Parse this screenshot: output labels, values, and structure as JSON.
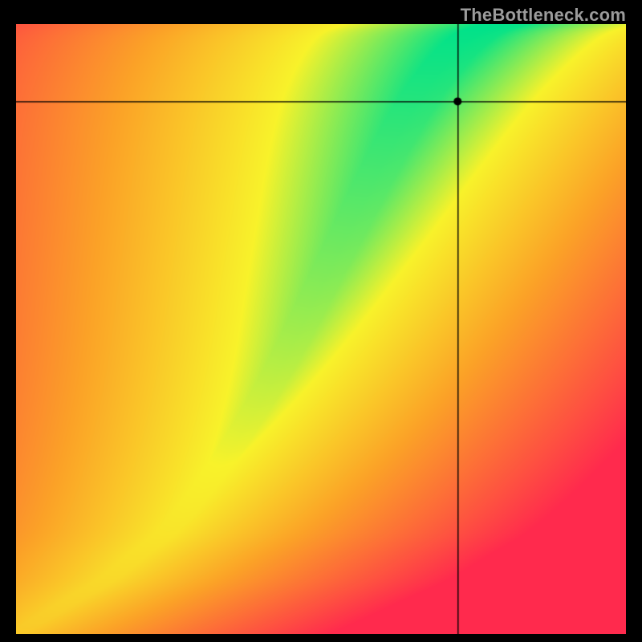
{
  "watermark": "TheBottleneck.com",
  "chart_data": {
    "type": "heatmap",
    "title": "",
    "xlabel": "",
    "ylabel": "",
    "xlim": [
      0,
      1
    ],
    "ylim": [
      0,
      1
    ],
    "crosshair": {
      "x": 0.725,
      "y": 0.873
    },
    "marker": {
      "x": 0.725,
      "y": 0.873
    },
    "ideal_curve_samples": {
      "x": [
        0.0,
        0.05,
        0.1,
        0.15,
        0.2,
        0.25,
        0.3,
        0.35,
        0.4,
        0.45,
        0.5,
        0.55,
        0.6,
        0.65,
        0.7,
        0.75,
        0.8
      ],
      "y_ideal": [
        0.0,
        0.03,
        0.06,
        0.09,
        0.13,
        0.17,
        0.23,
        0.3,
        0.38,
        0.47,
        0.57,
        0.67,
        0.77,
        0.86,
        0.93,
        0.98,
        1.0
      ]
    },
    "ridge_halfwidth": 0.05,
    "color_stops": [
      {
        "t": 0.0,
        "color": "#00e28a"
      },
      {
        "t": 0.25,
        "color": "#f8f22a"
      },
      {
        "t": 0.55,
        "color": "#fba227"
      },
      {
        "t": 1.0,
        "color": "#ff2a4d"
      }
    ]
  }
}
